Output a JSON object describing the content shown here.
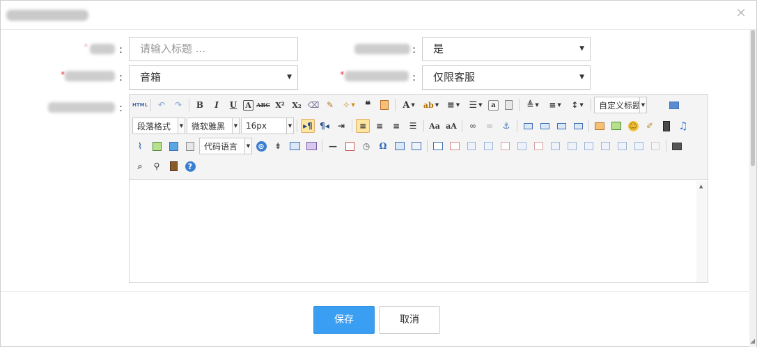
{
  "dialog": {
    "close_glyph": "×"
  },
  "form": {
    "title_field": {
      "placeholder": "请输入标题 ..."
    },
    "top_select": {
      "value": "是"
    },
    "category_select": {
      "value": "音箱"
    },
    "visibility_select": {
      "value": "仅限客服"
    },
    "colon": ":",
    "required_mark": "*"
  },
  "editor": {
    "toolbar": {
      "row1": [
        "HTML",
        "undo",
        "redo",
        "B",
        "I",
        "U",
        "A",
        "ABC",
        "X²",
        "X₂",
        "eraser",
        "brush",
        "magic",
        "❝",
        "paste",
        "A",
        "ab",
        "ordered-list",
        "unordered-list",
        "a",
        "page",
        "row-spacing",
        "para-spacing",
        "line-height"
      ],
      "custom_title": "自定义标题",
      "paragraph_format": "段落格式",
      "font_family": "微软雅黑",
      "font_size": "16px",
      "code_language": "代码语言",
      "omega": "Ω",
      "help": "?"
    }
  },
  "footer": {
    "save_label": "保存",
    "cancel_label": "取消"
  },
  "colors": {
    "primary": "#3a9ff2",
    "required": "#e4393c",
    "active_btn_bg": "#ffe69f"
  }
}
